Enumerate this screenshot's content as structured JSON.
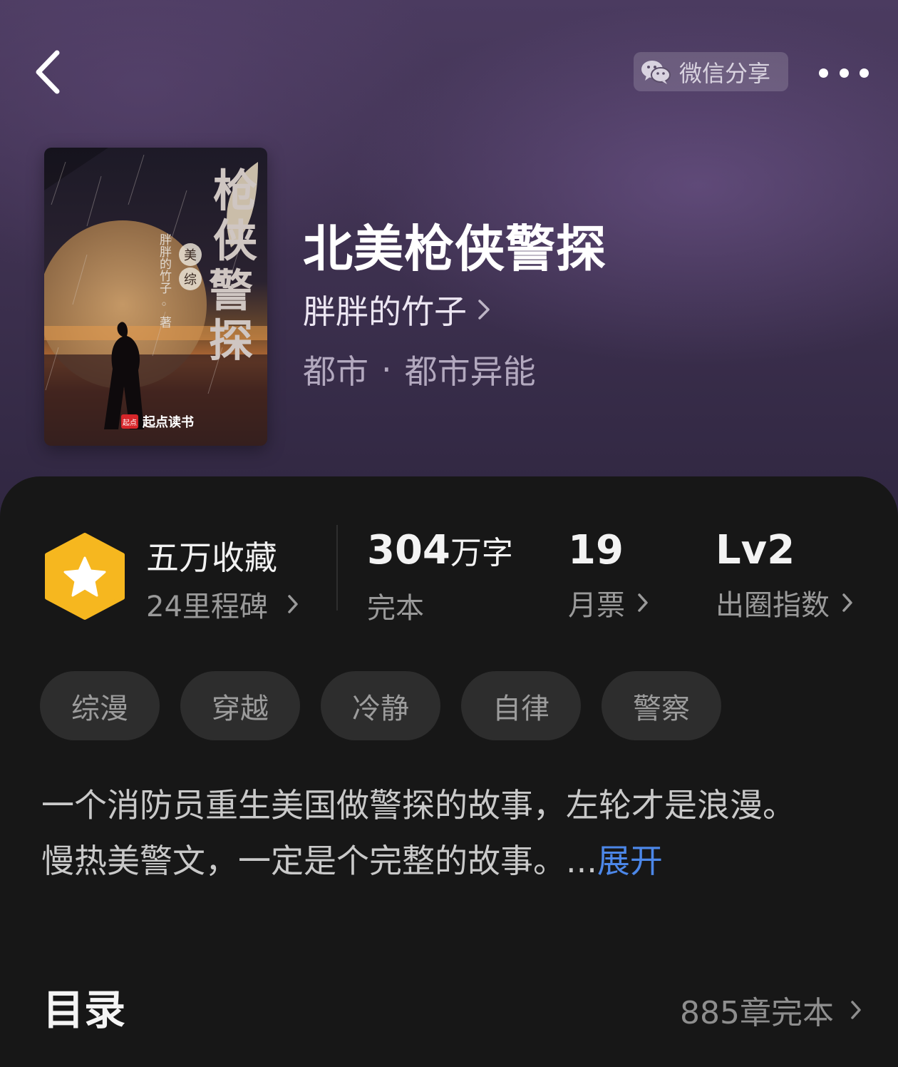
{
  "header": {
    "share_label": "微信分享"
  },
  "book": {
    "title": "北美枪侠警探",
    "author": "胖胖的竹子",
    "category": "都市",
    "genre_separator": "·",
    "subcategory": "都市异能",
    "cover": {
      "title_text": "枪侠警探",
      "badge_text": "美综",
      "author_text": "胖胖的竹子 ◦ 著",
      "publisher_mark": "起点",
      "publisher_text": "起点读书"
    }
  },
  "stats": {
    "collect_title": "五万收藏",
    "collect_sub": "24里程碑",
    "word_count_number": "304",
    "word_count_unit": "万字",
    "word_status": "完本",
    "monthly_votes": "19",
    "monthly_votes_label": "月票",
    "level": "Lv2",
    "level_label": "出圈指数"
  },
  "tags": [
    "综漫",
    "穿越",
    "冷静",
    "自律",
    "警察"
  ],
  "intro": {
    "line1": "一个消防员重生美国做警探的故事，左轮才是浪漫。",
    "line2": "慢热美警文，一定是个完整的故事。...",
    "expand_label": "展开"
  },
  "toc": {
    "title": "目录",
    "meta": "885章完本"
  },
  "colors": {
    "hero_top": "#4b3b60",
    "sheet_bg": "#171717",
    "tag_bg": "#2d2d2d",
    "badge_yellow": "#f6b71f",
    "link_blue": "#4c87e8"
  }
}
